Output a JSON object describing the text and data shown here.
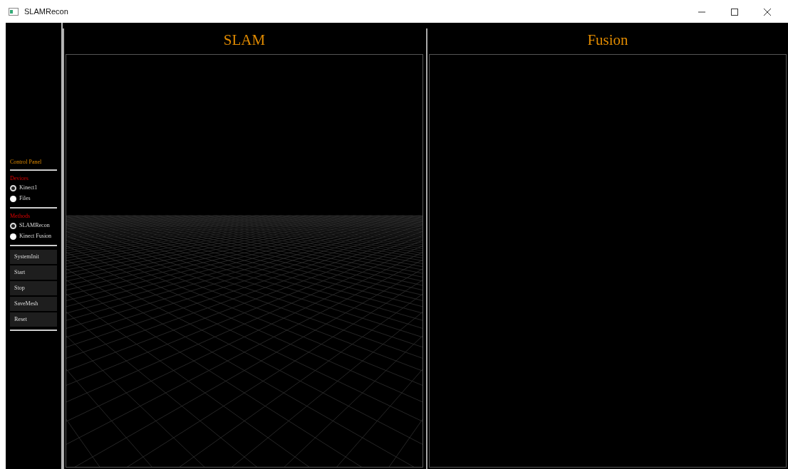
{
  "window": {
    "title": "SLAMRecon"
  },
  "control_panel": {
    "title": "Control Panel",
    "groups": [
      {
        "label": "Devices",
        "options": [
          {
            "label": "Kinect1",
            "selected": true
          },
          {
            "label": "Files",
            "selected": false
          }
        ]
      },
      {
        "label": "Methods",
        "options": [
          {
            "label": "SLAMRecon",
            "selected": true
          },
          {
            "label": "Kinect Fusion",
            "selected": false
          }
        ]
      }
    ],
    "buttons": [
      "SystemInit",
      "Start",
      "Stop",
      "SaveMesh",
      "Reset"
    ]
  },
  "views": [
    {
      "title": "SLAM",
      "kind": "grid"
    },
    {
      "title": "Fusion",
      "kind": "empty"
    }
  ]
}
